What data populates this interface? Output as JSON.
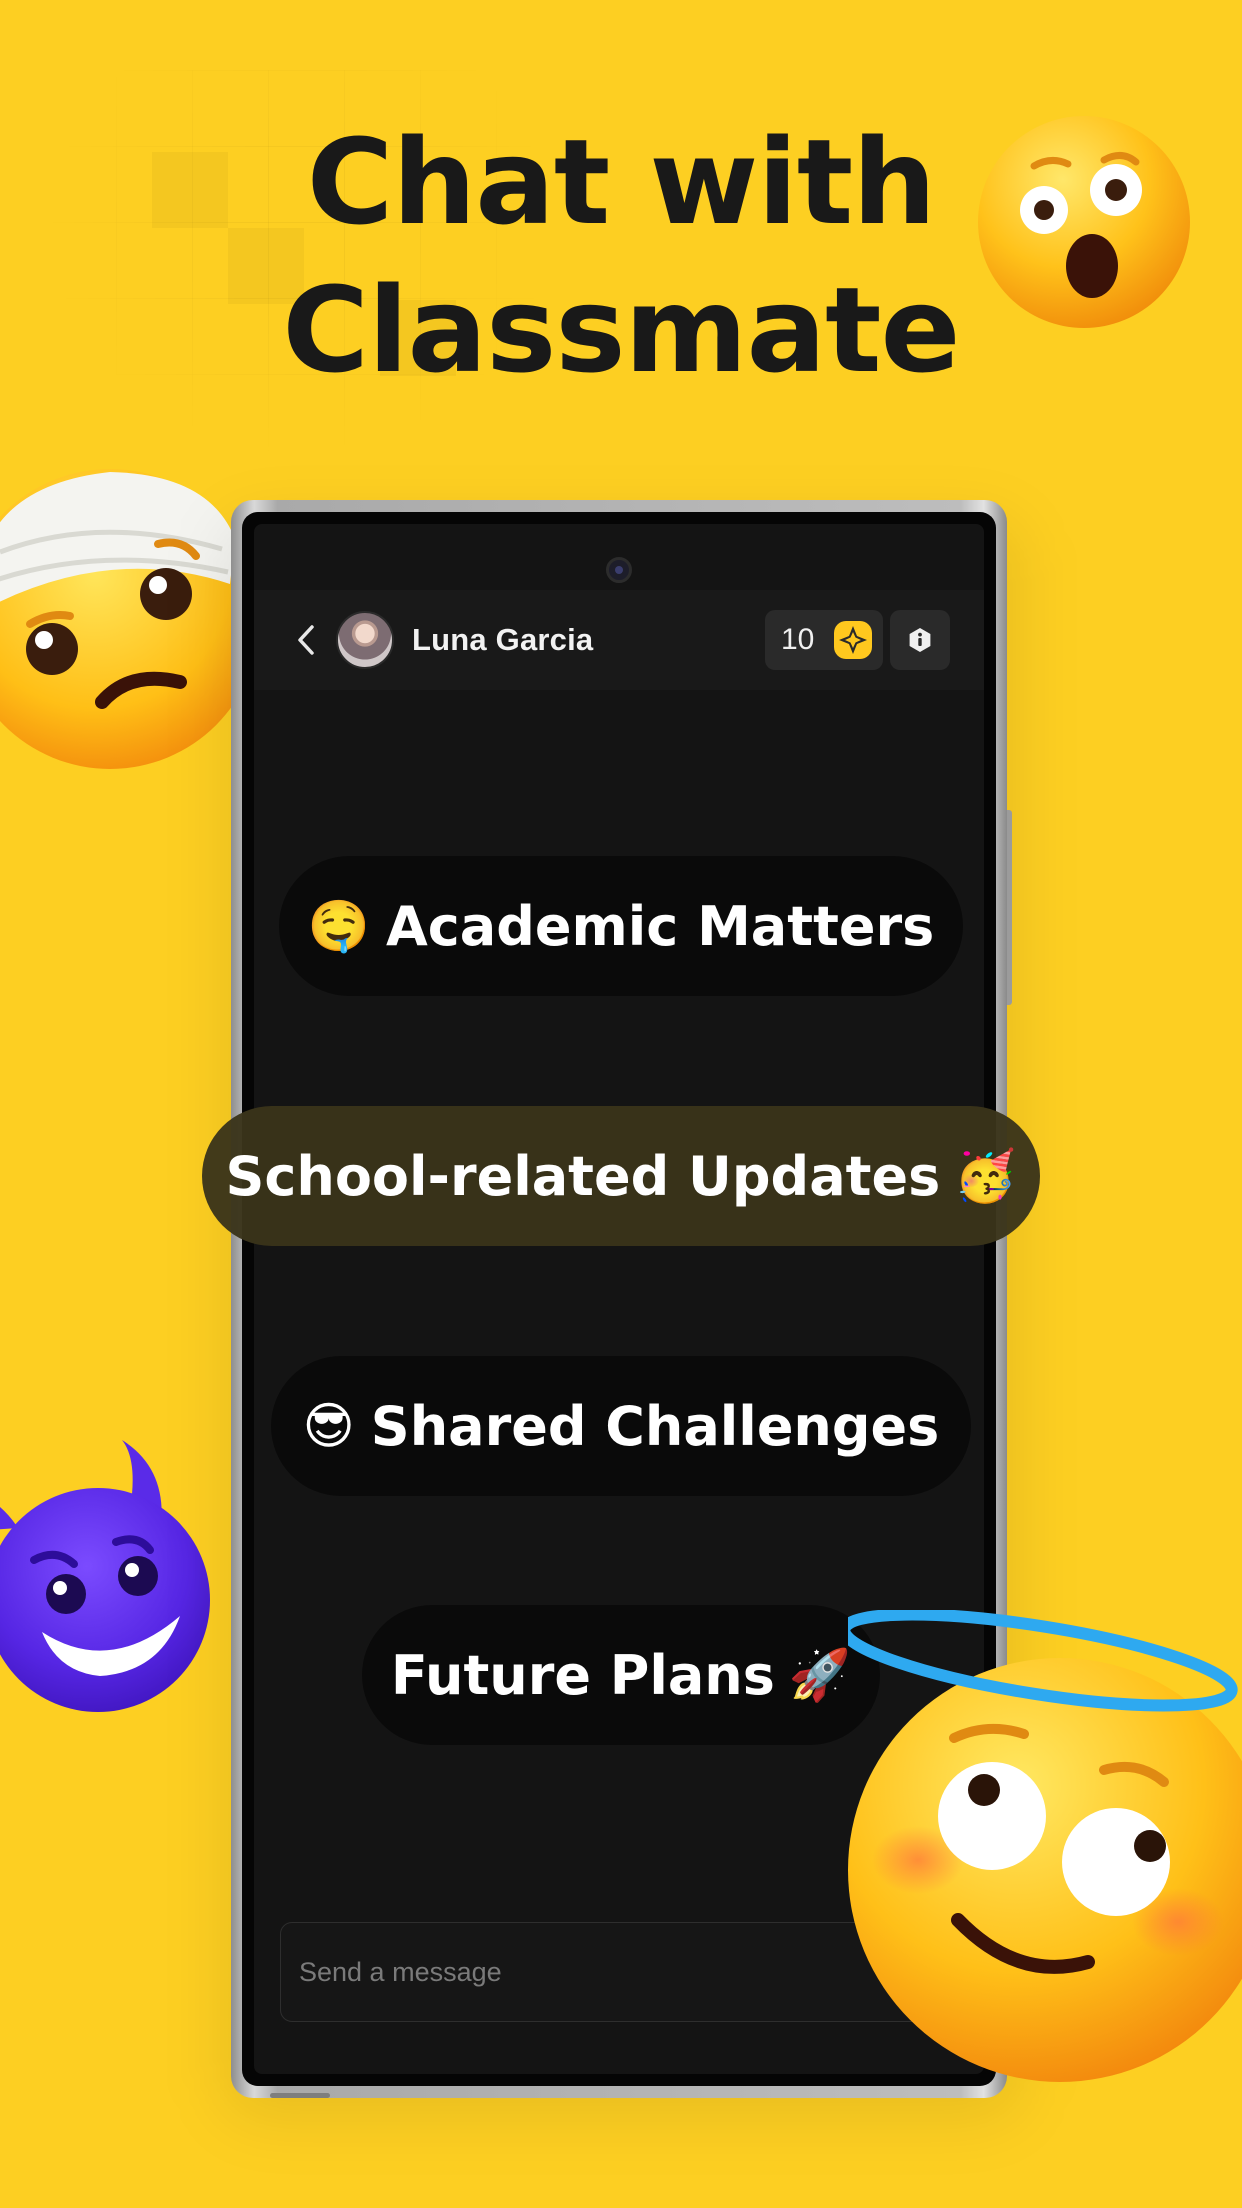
{
  "headline": {
    "line1": "Chat with",
    "line2": "Classmate"
  },
  "chat_header": {
    "contact_name": "Luna Garcia",
    "coin_count": "10"
  },
  "topics": [
    {
      "emoji": "🤤",
      "label": "Academic Matters",
      "emoji_position": "before"
    },
    {
      "emoji": "🥳",
      "label": "School-related Updates",
      "emoji_position": "after"
    },
    {
      "emoji": "😎",
      "label": "Shared Challenges",
      "emoji_position": "before"
    },
    {
      "emoji": "🚀",
      "label": "Future Plans",
      "emoji_position": "after"
    }
  ],
  "composer": {
    "placeholder": "Send a message"
  },
  "colors": {
    "background": "#FDCF22",
    "screen": "#141414",
    "bubble": "#0a0a0a",
    "headline": "#191919"
  },
  "decorative_emojis": [
    "head-bandage-emoji",
    "astonished-emoji",
    "smiling-devil-emoji",
    "halo-emoji"
  ]
}
